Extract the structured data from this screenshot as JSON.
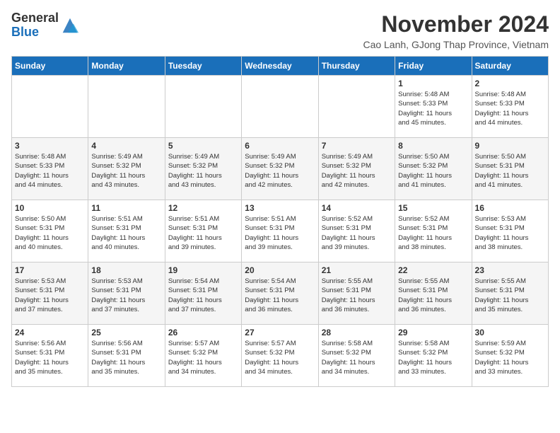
{
  "header": {
    "logo_general": "General",
    "logo_blue": "Blue",
    "month_title": "November 2024",
    "subtitle": "Cao Lanh, GJong Thap Province, Vietnam"
  },
  "calendar": {
    "days_of_week": [
      "Sunday",
      "Monday",
      "Tuesday",
      "Wednesday",
      "Thursday",
      "Friday",
      "Saturday"
    ],
    "weeks": [
      [
        {
          "day": "",
          "info": ""
        },
        {
          "day": "",
          "info": ""
        },
        {
          "day": "",
          "info": ""
        },
        {
          "day": "",
          "info": ""
        },
        {
          "day": "",
          "info": ""
        },
        {
          "day": "1",
          "info": "Sunrise: 5:48 AM\nSunset: 5:33 PM\nDaylight: 11 hours\nand 45 minutes."
        },
        {
          "day": "2",
          "info": "Sunrise: 5:48 AM\nSunset: 5:33 PM\nDaylight: 11 hours\nand 44 minutes."
        }
      ],
      [
        {
          "day": "3",
          "info": "Sunrise: 5:48 AM\nSunset: 5:33 PM\nDaylight: 11 hours\nand 44 minutes."
        },
        {
          "day": "4",
          "info": "Sunrise: 5:49 AM\nSunset: 5:32 PM\nDaylight: 11 hours\nand 43 minutes."
        },
        {
          "day": "5",
          "info": "Sunrise: 5:49 AM\nSunset: 5:32 PM\nDaylight: 11 hours\nand 43 minutes."
        },
        {
          "day": "6",
          "info": "Sunrise: 5:49 AM\nSunset: 5:32 PM\nDaylight: 11 hours\nand 42 minutes."
        },
        {
          "day": "7",
          "info": "Sunrise: 5:49 AM\nSunset: 5:32 PM\nDaylight: 11 hours\nand 42 minutes."
        },
        {
          "day": "8",
          "info": "Sunrise: 5:50 AM\nSunset: 5:32 PM\nDaylight: 11 hours\nand 41 minutes."
        },
        {
          "day": "9",
          "info": "Sunrise: 5:50 AM\nSunset: 5:31 PM\nDaylight: 11 hours\nand 41 minutes."
        }
      ],
      [
        {
          "day": "10",
          "info": "Sunrise: 5:50 AM\nSunset: 5:31 PM\nDaylight: 11 hours\nand 40 minutes."
        },
        {
          "day": "11",
          "info": "Sunrise: 5:51 AM\nSunset: 5:31 PM\nDaylight: 11 hours\nand 40 minutes."
        },
        {
          "day": "12",
          "info": "Sunrise: 5:51 AM\nSunset: 5:31 PM\nDaylight: 11 hours\nand 39 minutes."
        },
        {
          "day": "13",
          "info": "Sunrise: 5:51 AM\nSunset: 5:31 PM\nDaylight: 11 hours\nand 39 minutes."
        },
        {
          "day": "14",
          "info": "Sunrise: 5:52 AM\nSunset: 5:31 PM\nDaylight: 11 hours\nand 39 minutes."
        },
        {
          "day": "15",
          "info": "Sunrise: 5:52 AM\nSunset: 5:31 PM\nDaylight: 11 hours\nand 38 minutes."
        },
        {
          "day": "16",
          "info": "Sunrise: 5:53 AM\nSunset: 5:31 PM\nDaylight: 11 hours\nand 38 minutes."
        }
      ],
      [
        {
          "day": "17",
          "info": "Sunrise: 5:53 AM\nSunset: 5:31 PM\nDaylight: 11 hours\nand 37 minutes."
        },
        {
          "day": "18",
          "info": "Sunrise: 5:53 AM\nSunset: 5:31 PM\nDaylight: 11 hours\nand 37 minutes."
        },
        {
          "day": "19",
          "info": "Sunrise: 5:54 AM\nSunset: 5:31 PM\nDaylight: 11 hours\nand 37 minutes."
        },
        {
          "day": "20",
          "info": "Sunrise: 5:54 AM\nSunset: 5:31 PM\nDaylight: 11 hours\nand 36 minutes."
        },
        {
          "day": "21",
          "info": "Sunrise: 5:55 AM\nSunset: 5:31 PM\nDaylight: 11 hours\nand 36 minutes."
        },
        {
          "day": "22",
          "info": "Sunrise: 5:55 AM\nSunset: 5:31 PM\nDaylight: 11 hours\nand 36 minutes."
        },
        {
          "day": "23",
          "info": "Sunrise: 5:55 AM\nSunset: 5:31 PM\nDaylight: 11 hours\nand 35 minutes."
        }
      ],
      [
        {
          "day": "24",
          "info": "Sunrise: 5:56 AM\nSunset: 5:31 PM\nDaylight: 11 hours\nand 35 minutes."
        },
        {
          "day": "25",
          "info": "Sunrise: 5:56 AM\nSunset: 5:31 PM\nDaylight: 11 hours\nand 35 minutes."
        },
        {
          "day": "26",
          "info": "Sunrise: 5:57 AM\nSunset: 5:32 PM\nDaylight: 11 hours\nand 34 minutes."
        },
        {
          "day": "27",
          "info": "Sunrise: 5:57 AM\nSunset: 5:32 PM\nDaylight: 11 hours\nand 34 minutes."
        },
        {
          "day": "28",
          "info": "Sunrise: 5:58 AM\nSunset: 5:32 PM\nDaylight: 11 hours\nand 34 minutes."
        },
        {
          "day": "29",
          "info": "Sunrise: 5:58 AM\nSunset: 5:32 PM\nDaylight: 11 hours\nand 33 minutes."
        },
        {
          "day": "30",
          "info": "Sunrise: 5:59 AM\nSunset: 5:32 PM\nDaylight: 11 hours\nand 33 minutes."
        }
      ]
    ]
  }
}
